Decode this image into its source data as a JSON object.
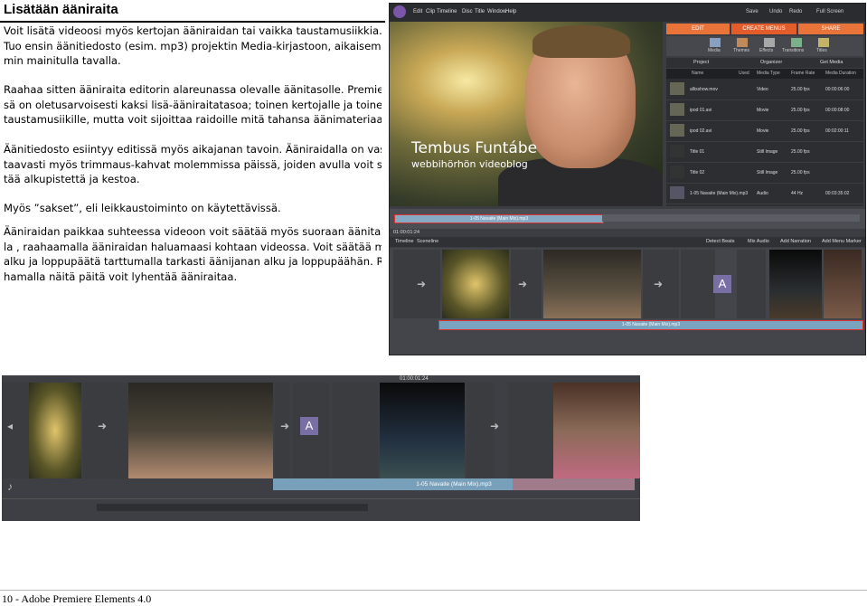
{
  "heading": "Lisätään ääniraita",
  "paragraphs": [
    [
      "Voit lisätä videoosi myös kertojan ääniraidan tai vaikka taustamusiikkia.",
      "Tuo ensin äänitiedosto (esim. mp3) projektin Media-kirjastoon, aikaisem-",
      "min mainitulla tavalla."
    ],
    [
      "Raahaa sitten ääniraita editorin alareunassa olevalle äänitasolle. Premieres-",
      "sä on oletusarvoisesti kaksi lisä-ääniraitatasoa; toinen kertojalle ja toinen",
      "taustamusiikille, mutta voit sijoittaa raidoille mitä tahansa äänimateriaalia."
    ],
    [
      "Äänitiedosto esiintyy editissä myös aikajanan tavoin. Ääniraidalla on vas-",
      "taavasti myös trimmaus-kahvat molemmissa päissä, joiden avulla voit sää-",
      "tää alkupistettä ja kestoa."
    ],
    [
      "Myös ”sakset”, eli leikkaustoiminto on käytettävissä."
    ],
    [
      "Ääniraidan paikkaa suhteessa videoon voit säätää myös suoraan äänitasol-",
      "la , raahaamalla ääniraidan haluamaasi kohtaan videossa. Voit säätää myös",
      "alku ja loppupäätä tarttumalla tarkasti äänijanan alku ja loppupäähän. Raa-",
      "hamalla näitä päitä voit lyhentää ääniraitaa."
    ]
  ],
  "footer": "10 - Adobe Premiere Elements 4.0",
  "app": {
    "menu": [
      "Edit",
      "Clip",
      "Timeline",
      "Disc",
      "Title",
      "Window",
      "Help"
    ],
    "save": "Save",
    "undo": "Undo",
    "redo": "Redo",
    "full_screen": "Full Screen",
    "top_tabs": [
      "EDIT",
      "CREATE MENUS",
      "SHARE"
    ],
    "tools": [
      "Media",
      "Themes",
      "Effects",
      "Transitions",
      "Titles"
    ],
    "subtabs": [
      "Project",
      "Organizer",
      "Get Media"
    ],
    "media_columns": [
      "Name",
      "Used",
      "Media Type",
      "Frame Rate",
      "Media Duration"
    ],
    "media_rows": [
      {
        "name": "allisshow.mov",
        "type": "Video",
        "rate": "25.00 fps",
        "dur": "00:00:06:00"
      },
      {
        "name": "ipod 01.avi",
        "type": "Movie",
        "rate": "25.00 fps",
        "dur": "00:00:08:00"
      },
      {
        "name": "ipod 02.avi",
        "type": "Movie",
        "rate": "25.00 fps",
        "dur": "00:02:00:11"
      },
      {
        "name": "Title 01",
        "type": "Still Image",
        "rate": "25.00 fps",
        "dur": ""
      },
      {
        "name": "Title 02",
        "type": "Still Image",
        "rate": "25.00 fps",
        "dur": ""
      },
      {
        "name": "1-05 Navaite (Main Mix).mp3",
        "type": "Audio",
        "rate": "44 Hz",
        "dur": "00:03:35:02"
      }
    ],
    "preview_title": "Tembus Funtábe",
    "preview_subtitle": "webbihörhön videoblog",
    "scrub_label": "1-05 Navaite (Main Mix).mp3",
    "timecode": "01:00:01:24",
    "timeline_tabs": [
      "Timeline",
      "Sceneline"
    ],
    "timeline_actions": [
      "Detect Beats",
      "Mix Audio",
      "Add Narration",
      "Add Menu Marker"
    ],
    "audio_clip_label": "1-05 Navaite (Main Mix).mp3"
  },
  "zoom": {
    "audio_clip_label": "1-05 Navaite (Main Mix).mp3",
    "timecode": "01:00:01:24"
  }
}
